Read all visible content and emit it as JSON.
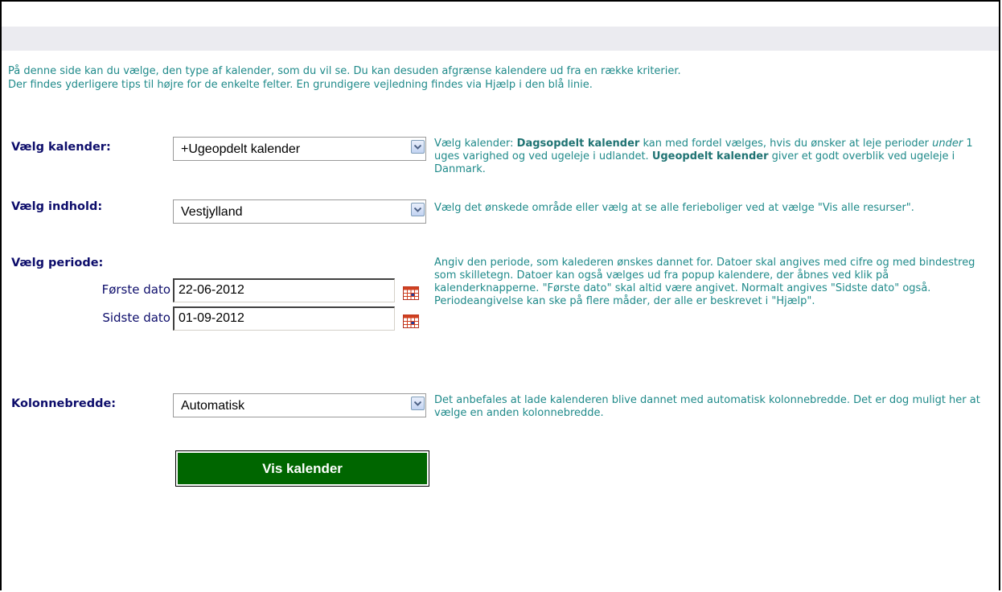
{
  "intro": {
    "line1": "På denne side kan du vælge, den type af kalender, som du vil se. Du kan desuden afgrænse kalendere ud fra en række kriterier.",
    "line2": "Der findes yderligere tips til højre for de enkelte felter. En grundigere vejledning findes via Hjælp i den blå linie."
  },
  "calendar": {
    "label": "Vælg kalender:",
    "value": "+Ugeopdelt kalender",
    "help_a": "Vælg kalender: ",
    "help_b": "Dagsopdelt kalender",
    "help_c": " kan med fordel vælges, hvis du ønsker at leje perioder ",
    "help_d": "under",
    "help_e": " 1 uges varighed og ved ugeleje i udlandet. ",
    "help_f": "Ugeopdelt kalender",
    "help_g": " giver et godt overblik ved ugeleje i Danmark."
  },
  "content": {
    "label": "Vælg indhold:",
    "value": "Vestjylland",
    "help": "Vælg det ønskede område eller vælg at se alle ferieboliger ved at vælge \"Vis alle resurser\"."
  },
  "period": {
    "label": "Vælg periode:",
    "first_label": "Første dato",
    "first_value": "22-06-2012",
    "last_label": "Sidste dato",
    "last_value": "01-09-2012",
    "help": "Angiv den periode, som kalederen ønskes dannet for. Datoer skal angives med cifre og med bindestreg som skilletegn. Datoer kan også vælges ud fra popup kalendere, der åbnes ved klik på kalenderknapperne. \"Første dato\" skal altid være angivet. Normalt angives \"Sidste dato\" også. Periodeangivelse kan ske på flere måder, der alle er beskrevet i \"Hjælp\"."
  },
  "column_width": {
    "label": "Kolonnebredde:",
    "value": "Automatisk",
    "help": "Det anbefales at lade kalenderen blive dannet med automatisk kolonnebredde. Det er dog muligt her at vælge en anden kolonnebredde."
  },
  "submit": {
    "label": "Vis kalender"
  },
  "icons": {
    "dropdown": "chevron-down-icon",
    "calendar": "calendar-icon"
  },
  "colors": {
    "label": "#0d0d6b",
    "help_text": "#1f8a8a",
    "button": "#006600",
    "topbar": "#ebebf0"
  }
}
